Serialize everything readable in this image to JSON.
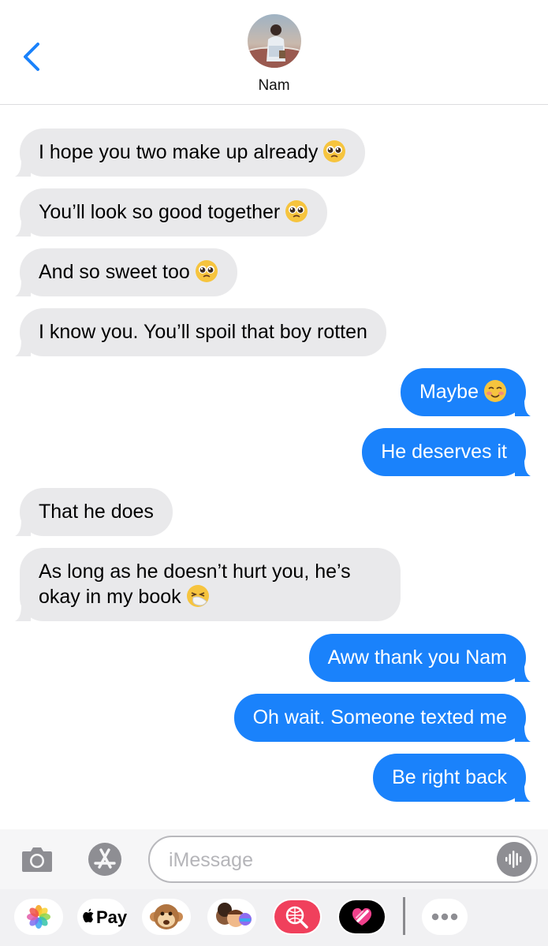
{
  "header": {
    "contact_name": "Nam"
  },
  "messages": [
    {
      "side": "in",
      "text": "I hope you two make up already",
      "emoji": "pleading-face"
    },
    {
      "side": "in",
      "text": "You’ll look so good together",
      "emoji": "pleading-face"
    },
    {
      "side": "in",
      "text": "And so sweet too",
      "emoji": "pleading-face"
    },
    {
      "side": "in",
      "text": "I know you. You’ll spoil that boy rotten",
      "emoji": ""
    },
    {
      "side": "out",
      "text": "Maybe",
      "emoji": "smiling-face"
    },
    {
      "side": "out",
      "text": "He deserves it",
      "emoji": ""
    },
    {
      "side": "in",
      "text": "That he does",
      "emoji": ""
    },
    {
      "side": "in",
      "text": "As long as he doesn’t hurt you, he’s okay in my book",
      "emoji": "sneezing-face"
    },
    {
      "side": "out",
      "text": "Aww thank you Nam",
      "emoji": ""
    },
    {
      "side": "out",
      "text": "Oh wait. Someone texted me",
      "emoji": ""
    },
    {
      "side": "out",
      "text": "Be right back",
      "emoji": ""
    }
  ],
  "composer": {
    "placeholder": "iMessage"
  },
  "app_drawer": {
    "items": [
      "photos-app",
      "apple-pay",
      "animoji",
      "memoji-stickers",
      "image-search",
      "digital-touch",
      "more"
    ],
    "apple_pay_label": "Pay"
  },
  "colors": {
    "accent": "#1a82fb",
    "incoming_bubble": "#e9e9eb",
    "back_chevron": "#1a82fb"
  }
}
